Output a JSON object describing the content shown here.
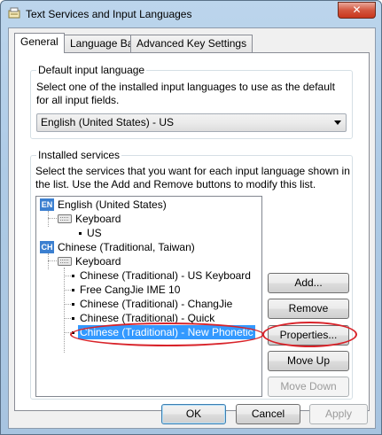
{
  "window": {
    "title": "Text Services and Input Languages",
    "close_glyph": "✕"
  },
  "tabs": [
    {
      "label": "General",
      "active": true
    },
    {
      "label": "Language Bar",
      "active": false
    },
    {
      "label": "Advanced Key Settings",
      "active": false
    }
  ],
  "default_language": {
    "group_label": "Default input language",
    "description": "Select one of the installed input languages to use as the default for all input fields.",
    "selected": "English (United States) - US"
  },
  "installed_services": {
    "group_label": "Installed services",
    "description": "Select the services that you want for each input language shown in the list. Use the Add and Remove buttons to modify this list.",
    "tree": [
      {
        "kind": "language",
        "badge": "EN",
        "label": "English (United States)"
      },
      {
        "kind": "category",
        "icon": "keyboard-icon",
        "label": "Keyboard"
      },
      {
        "kind": "item",
        "label": "US"
      },
      {
        "kind": "language",
        "badge": "CH",
        "label": "Chinese (Traditional, Taiwan)"
      },
      {
        "kind": "category",
        "icon": "keyboard-icon",
        "label": "Keyboard"
      },
      {
        "kind": "item",
        "label": "Chinese (Traditional) - US Keyboard"
      },
      {
        "kind": "item",
        "label": "Free CangJie IME 10"
      },
      {
        "kind": "item",
        "label": "Chinese (Traditional) - ChangJie"
      },
      {
        "kind": "item",
        "label": "Chinese (Traditional) - Quick"
      },
      {
        "kind": "item",
        "label": "Chinese (Traditional) - New Phonetic",
        "selected": true
      }
    ],
    "buttons": {
      "add": "Add...",
      "remove": "Remove",
      "properties": "Properties...",
      "move_up": "Move Up",
      "move_down": "Move Down"
    }
  },
  "footer": {
    "ok": "OK",
    "cancel": "Cancel",
    "apply": "Apply"
  },
  "colors": {
    "selection": "#3399ff",
    "highlight_ellipse": "#d8232a",
    "language_badge": "#3b7fd0"
  }
}
